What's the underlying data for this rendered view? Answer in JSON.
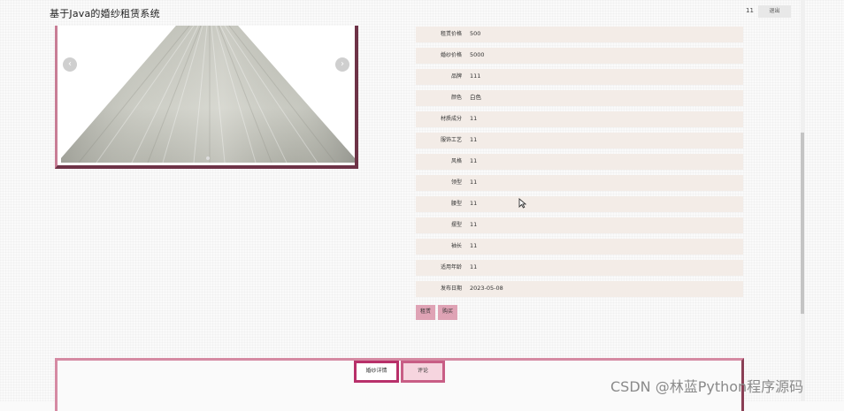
{
  "header": {
    "app_title": "基于Java的婚纱租赁系统",
    "user_id": "11",
    "logout_label": "退出"
  },
  "carousel": {
    "prev_icon": "chevron-left-icon",
    "next_icon": "chevron-right-icon",
    "prev_glyph": "‹",
    "next_glyph": "›"
  },
  "details": [
    {
      "label": "租赁价格",
      "value": "500"
    },
    {
      "label": "婚纱价格",
      "value": "5000"
    },
    {
      "label": "品牌",
      "value": "111"
    },
    {
      "label": "颜色",
      "value": "白色"
    },
    {
      "label": "材质成分",
      "value": "11"
    },
    {
      "label": "服饰工艺",
      "value": "11"
    },
    {
      "label": "风格",
      "value": "11"
    },
    {
      "label": "领型",
      "value": "11"
    },
    {
      "label": "腰型",
      "value": "11"
    },
    {
      "label": "摆型",
      "value": "11"
    },
    {
      "label": "袖长",
      "value": "11"
    },
    {
      "label": "适用年龄",
      "value": "11"
    },
    {
      "label": "发布日期",
      "value": "2023-05-08"
    }
  ],
  "actions": {
    "rent_label": "租赁",
    "buy_label": "购买"
  },
  "tabs": [
    {
      "label": "婚纱详情",
      "active": true
    },
    {
      "label": "评论",
      "active": false
    }
  ],
  "watermark": "CSDN @林蓝Python程序源码",
  "colors": {
    "accent": "#c85d85",
    "accent_dark": "#6e3347",
    "row_bg": "#f3ece7",
    "button_bg": "#dfa3b5"
  }
}
